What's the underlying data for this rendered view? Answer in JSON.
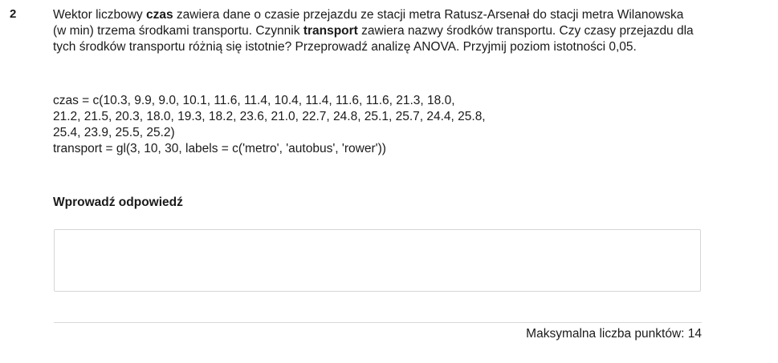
{
  "question": {
    "number": "2",
    "text_parts": [
      "Wektor liczbowy ",
      "czas",
      " zawiera dane o czasie przejazdu ze stacji metra Ratusz-Arsenał do stacji metra Wilanowska (w min) trzema środkami transportu. Czynnik ",
      "transport",
      " zawiera nazwy środków transportu. Czy czasy przejazdu dla tych środków transportu różnią się istotnie? Przeprowadź analizę ANOVA. Przyjmij poziom istotności 0,05."
    ],
    "code_lines": [
      "czas = c(10.3, 9.9, 9.0, 10.1, 11.6, 11.4, 10.4, 11.4, 11.6, 11.6, 21.3, 18.0,",
      "21.2, 21.5, 20.3, 18.0, 19.3, 18.2, 23.6, 21.0, 22.7, 24.8, 25.1, 25.7, 24.4, 25.8,",
      "25.4, 23.9, 25.5, 25.2)",
      "transport = gl(3, 10, 30, labels = c('metro', 'autobus', 'rower'))"
    ]
  },
  "answer": {
    "label": "Wprowadź odpowiedź",
    "value": ""
  },
  "footer": {
    "max_points": "Maksymalna liczba punktów: 14"
  }
}
